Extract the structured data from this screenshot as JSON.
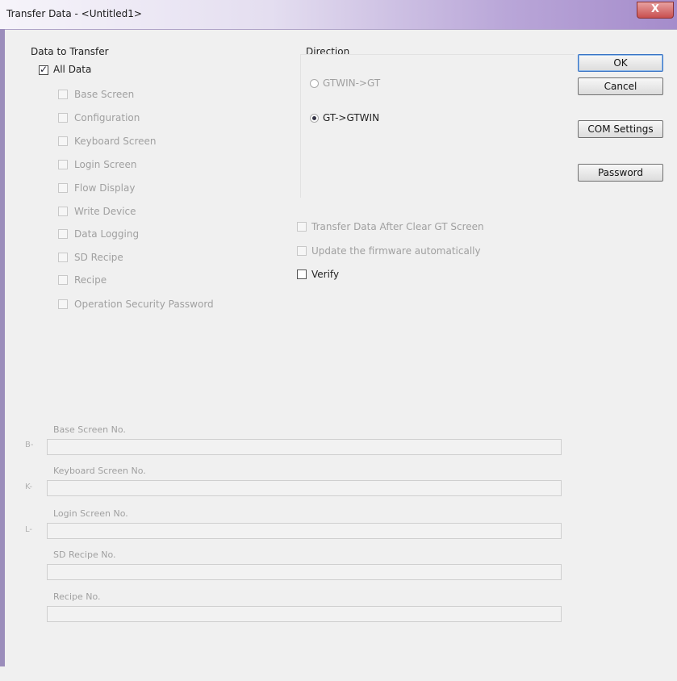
{
  "window": {
    "title": "Transfer Data - <Untitled1>",
    "close": "X"
  },
  "data_to_transfer": {
    "label": "Data to Transfer",
    "all": {
      "label": "All Data",
      "checked": true
    },
    "items": [
      "Base Screen",
      "Configuration",
      "Keyboard Screen",
      "Login Screen",
      "Flow Display",
      "Write Device",
      "Data Logging",
      "SD Recipe",
      "Recipe",
      "Operation Security Password"
    ]
  },
  "direction": {
    "label": "Direction",
    "options": [
      {
        "label": "GTWIN->GT",
        "selected": false
      },
      {
        "label": "GT->GTWIN",
        "selected": true
      }
    ]
  },
  "options": {
    "clear_screen": "Transfer Data After Clear GT Screen",
    "update_firmware": "Update the firmware automatically",
    "verify": "Verify"
  },
  "buttons": {
    "ok": "OK",
    "cancel": "Cancel",
    "com_settings": "COM Settings",
    "password": "Password"
  },
  "fields": {
    "base_screen": {
      "label": "Base Screen No.",
      "prefix": "B-"
    },
    "keyboard_screen": {
      "label": "Keyboard Screen No.",
      "prefix": "K-"
    },
    "login_screen": {
      "label": "Login Screen No.",
      "prefix": "L-"
    },
    "sd_recipe": {
      "label": "SD Recipe No."
    },
    "recipe": {
      "label": "Recipe No."
    }
  }
}
